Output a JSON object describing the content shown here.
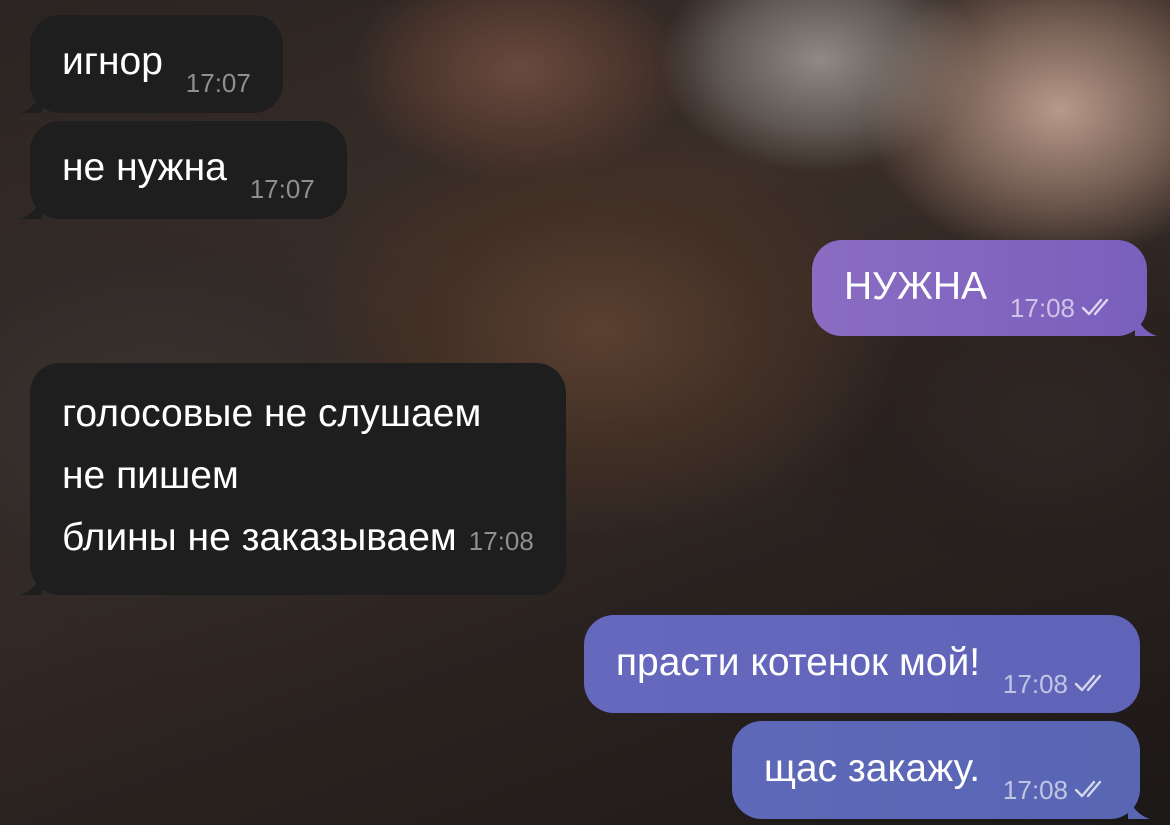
{
  "messages": [
    {
      "id": "b1",
      "direction": "incoming",
      "text": "игнор",
      "time": "17:07"
    },
    {
      "id": "b2",
      "direction": "incoming",
      "text": "не нужна",
      "time": "17:07"
    },
    {
      "id": "b3",
      "direction": "outgoing",
      "text": "НУЖНА",
      "time": "17:08",
      "status": "read-double-check"
    },
    {
      "id": "b4",
      "direction": "incoming",
      "lines": [
        "голосовые не слушаем",
        "не пишем",
        "блины не заказываем"
      ],
      "time": "17:08"
    },
    {
      "id": "b5",
      "direction": "outgoing",
      "text": "прасти котенок мой!",
      "time": "17:08",
      "status": "read-double-check"
    },
    {
      "id": "b6",
      "direction": "outgoing",
      "text": "щас закажу.",
      "time": "17:08",
      "status": "read-double-check"
    }
  ],
  "colors": {
    "incoming_bubble": "#1e1e1f",
    "outgoing_bubble_purple": "#8a6cc2",
    "outgoing_bubble_blue": "#6066b8",
    "timestamp_incoming": "#8e8e93"
  }
}
